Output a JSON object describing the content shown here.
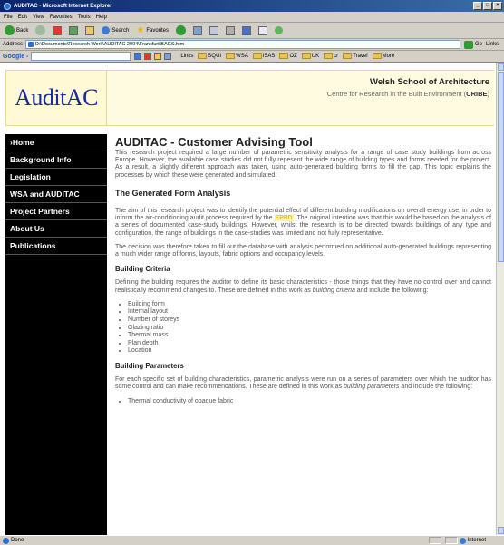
{
  "window": {
    "title": "AUDITAC - Microsoft Internet Explorer",
    "ctrl_min": "_",
    "ctrl_max": "□",
    "ctrl_close": "×"
  },
  "menubar": [
    "File",
    "Edit",
    "View",
    "Favorites",
    "Tools",
    "Help"
  ],
  "toolbar": {
    "back_label": "Back",
    "search_label": "Search",
    "favorites_label": "Favorites"
  },
  "address": {
    "label": "Address",
    "value": "D:\\Documents\\Research Work\\AUDITAC 2004\\Frankfurt\\BAGS.htm",
    "go_label": "Go",
    "links_label": "Links"
  },
  "googlebar": {
    "logo": "Google -",
    "links_label": "Links",
    "folders": [
      "SQUI",
      "WSA",
      "ISAS",
      "OZ",
      "UK",
      "cr",
      "Travel",
      "More"
    ]
  },
  "header": {
    "logo": "AuditAC",
    "school": "Welsh School of Architecture",
    "centre": "Centre for Research in the Built Environment (",
    "centre_abbr": "CRIBE",
    "centre_end": ")"
  },
  "nav": [
    {
      "label": "Home",
      "active": true
    },
    {
      "label": "Background Info",
      "active": false
    },
    {
      "label": "Legislation",
      "active": false
    },
    {
      "label": "WSA and AUDITAC",
      "active": false
    },
    {
      "label": "Project Partners",
      "active": false
    },
    {
      "label": "About Us",
      "active": false
    },
    {
      "label": "Publications",
      "active": false
    }
  ],
  "main": {
    "title": "AUDITAC - Customer Advising Tool",
    "intro": "This research project required a large number of parametric sensitivity analysis for a range of case study buildings from across Europe. However, the available case studies did not fully repesent the wide range of building types and forms needed for the project. As a result, a slightly different approach was taken, using auto-generated building forms to fill the gap. This topic explains the processes by which these were generated and simulated.",
    "section1": "The Generated Form Analysis",
    "p1_a": "The aim of this research project was to identify the potential effect of different building modifications on overall energy use, in order to inform the air-conditioning audit process required by the ",
    "p1_link": "EPBD",
    "p1_b": ". The original intention was that this would be based on the analysis of a series of documented case-study buildings. However, whilst the research is to be directed towards buildings of any type and configuration, the range of buildings in the case-studies was limited and not fully representative.",
    "p2": "The decision was therefore taken to fill out the database with analysis performed on additional auto-generated buildings representing a much wider range of forms, layouts, fabric options and occupancy levels.",
    "sub1": "Building Criteria",
    "p3_a": "Defining the building requires the auditor to define its basic characteristics - those things that they have no control over and cannot realistically recommend changes to. These are defined in this work as ",
    "p3_em": "building criteria",
    "p3_b": " and include the following:",
    "criteria": [
      "Building form",
      "Internal layout",
      "Number of storeys",
      "Glazing ratio",
      "Thermal mass",
      "Plan depth",
      "Location"
    ],
    "sub2": "Building Parameters",
    "p4_a": "For each specific set of building characteristics, parametric analysis were run on a series of parameters over which the auditor has some control and can make recommendations. These are defined in this work as ",
    "p4_em": "building parameters",
    "p4_b": " and include the following:",
    "parameters": [
      "Thermal conductivity of opaque fabric"
    ]
  },
  "status": {
    "left": "Done",
    "zone": "Internet"
  }
}
